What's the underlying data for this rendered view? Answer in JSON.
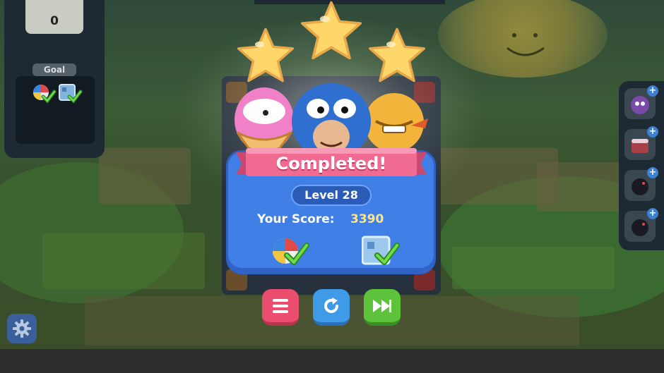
{
  "hud": {
    "moves_value": "0",
    "goal_label": "Goal",
    "goal_items": [
      {
        "icon": "beach-ball-icon",
        "done": true
      },
      {
        "icon": "ice-block-icon",
        "done": true
      }
    ],
    "boosters": [
      {
        "icon": "purple-creature-booster-icon"
      },
      {
        "icon": "cake-booster-icon"
      },
      {
        "icon": "bomb-booster-icon"
      },
      {
        "icon": "bomb-booster-icon"
      }
    ],
    "settings_icon": "gear-icon"
  },
  "result": {
    "stars_earned": 3,
    "stars_total": 3,
    "title": "Completed!",
    "level_label": "Level 28",
    "score_label": "Your Score:",
    "score_value": "3390",
    "goals": [
      {
        "icon": "beach-ball-icon",
        "done": true
      },
      {
        "icon": "ice-block-icon",
        "done": true
      }
    ]
  },
  "buttons": [
    {
      "name": "menu-button",
      "icon": "menu-icon"
    },
    {
      "name": "replay-button",
      "icon": "replay-icon"
    },
    {
      "name": "next-level-button",
      "icon": "fast-forward-icon"
    }
  ],
  "colors": {
    "dialog": "#3f7fe6",
    "ribbon": "#f06a92",
    "score_value": "#ffe680",
    "star": "#ffd66a",
    "menu_button": "#ea4d6d",
    "replay_button": "#3f9be8",
    "next_button": "#5cc33a"
  }
}
